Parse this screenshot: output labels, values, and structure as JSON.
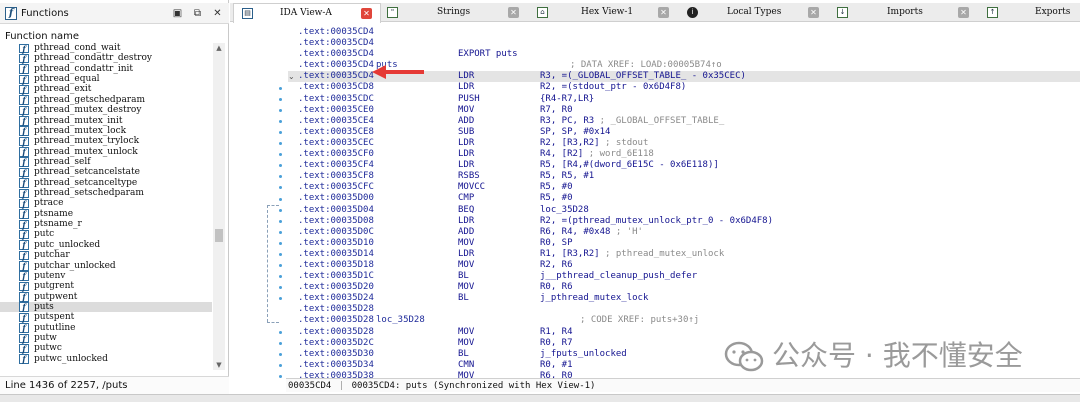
{
  "functions_panel": {
    "title": "Functions",
    "column_header": "Function name",
    "items": [
      "pthread_cond_wait",
      "pthread_condattr_destroy",
      "pthread_condattr_init",
      "pthread_equal",
      "pthread_exit",
      "pthread_getschedparam",
      "pthread_mutex_destroy",
      "pthread_mutex_init",
      "pthread_mutex_lock",
      "pthread_mutex_trylock",
      "pthread_mutex_unlock",
      "pthread_self",
      "pthread_setcancelstate",
      "pthread_setcanceltype",
      "pthread_setschedparam",
      "ptrace",
      "ptsname",
      "ptsname_r",
      "putc",
      "putc_unlocked",
      "putchar",
      "putchar_unlocked",
      "putenv",
      "putgrent",
      "putpwent",
      "puts",
      "putspent",
      "pututline",
      "putw",
      "putwc",
      "putwc_unlocked"
    ],
    "selected_item": "puts",
    "status": "Line 1436 of 2257, /puts"
  },
  "tabs": [
    {
      "label": "IDA View-A",
      "icon": "ida-view-icon",
      "active": true
    },
    {
      "label": "Strings",
      "icon": "strings-icon",
      "active": false
    },
    {
      "label": "Hex View-1",
      "icon": "hex-view-icon",
      "active": false
    },
    {
      "label": "Local Types",
      "icon": "local-types-icon",
      "active": false
    },
    {
      "label": "Imports",
      "icon": "imports-icon",
      "active": false
    },
    {
      "label": "Exports",
      "icon": "exports-icon",
      "active": false
    }
  ],
  "disasm_lines": [
    {
      "addr": ".text:00035CD4",
      "label": "",
      "mnem": "",
      "ops": "",
      "comment": ""
    },
    {
      "addr": ".text:00035CD4",
      "label": "",
      "mnem": "",
      "ops": "",
      "comment": ""
    },
    {
      "addr": ".text:00035CD4",
      "label": "",
      "mnem": "EXPORT puts",
      "ops": "",
      "comment": ""
    },
    {
      "addr": ".text:00035CD4",
      "label": "puts",
      "mnem": "",
      "ops": "",
      "comment": "; DATA XREF: LOAD:00005B74↑o"
    },
    {
      "addr": ".text:00035CD4",
      "label": "",
      "mnem": "LDR",
      "ops": "R3, =(_GLOBAL_OFFSET_TABLE_ - 0x35CEC)",
      "comment": "",
      "highlight": true
    },
    {
      "addr": ".text:00035CD8",
      "label": "",
      "mnem": "LDR",
      "ops": "R2, =(stdout_ptr - 0x6D4F8)",
      "comment": ""
    },
    {
      "addr": ".text:00035CDC",
      "label": "",
      "mnem": "PUSH",
      "ops": "{R4-R7,LR}",
      "comment": ""
    },
    {
      "addr": ".text:00035CE0",
      "label": "",
      "mnem": "MOV",
      "ops": "R7, R0",
      "comment": ""
    },
    {
      "addr": ".text:00035CE4",
      "label": "",
      "mnem": "ADD",
      "ops": "R3, PC, R3",
      "comment": "; _GLOBAL_OFFSET_TABLE_"
    },
    {
      "addr": ".text:00035CE8",
      "label": "",
      "mnem": "SUB",
      "ops": "SP, SP, #0x14",
      "comment": ""
    },
    {
      "addr": ".text:00035CEC",
      "label": "",
      "mnem": "LDR",
      "ops": "R2, [R3,R2]",
      "comment": "; stdout"
    },
    {
      "addr": ".text:00035CF0",
      "label": "",
      "mnem": "LDR",
      "ops": "R4, [R2]",
      "comment": "; word_6E118"
    },
    {
      "addr": ".text:00035CF4",
      "label": "",
      "mnem": "LDR",
      "ops": "R5, [R4,#(dword_6E15C - 0x6E118)]",
      "comment": ""
    },
    {
      "addr": ".text:00035CF8",
      "label": "",
      "mnem": "RSBS",
      "ops": "R5, R5, #1",
      "comment": ""
    },
    {
      "addr": ".text:00035CFC",
      "label": "",
      "mnem": "MOVCC",
      "ops": "R5, #0",
      "comment": ""
    },
    {
      "addr": ".text:00035D00",
      "label": "",
      "mnem": "CMP",
      "ops": "R5, #0",
      "comment": ""
    },
    {
      "addr": ".text:00035D04",
      "label": "",
      "mnem": "BEQ",
      "ops": "loc_35D28",
      "comment": ""
    },
    {
      "addr": ".text:00035D08",
      "label": "",
      "mnem": "LDR",
      "ops": "R2, =(pthread_mutex_unlock_ptr_0 - 0x6D4F8)",
      "comment": ""
    },
    {
      "addr": ".text:00035D0C",
      "label": "",
      "mnem": "ADD",
      "ops": "R6, R4, #0x48",
      "comment": "; 'H'"
    },
    {
      "addr": ".text:00035D10",
      "label": "",
      "mnem": "MOV",
      "ops": "R0, SP",
      "comment": ""
    },
    {
      "addr": ".text:00035D14",
      "label": "",
      "mnem": "LDR",
      "ops": "R1, [R3,R2]",
      "comment": "; pthread_mutex_unlock"
    },
    {
      "addr": ".text:00035D18",
      "label": "",
      "mnem": "MOV",
      "ops": "R2, R6",
      "comment": ""
    },
    {
      "addr": ".text:00035D1C",
      "label": "",
      "mnem": "BL",
      "ops": "j__pthread_cleanup_push_defer",
      "comment": ""
    },
    {
      "addr": ".text:00035D20",
      "label": "",
      "mnem": "MOV",
      "ops": "R0, R6",
      "comment": ""
    },
    {
      "addr": ".text:00035D24",
      "label": "",
      "mnem": "BL",
      "ops": "j_pthread_mutex_lock",
      "comment": ""
    },
    {
      "addr": ".text:00035D28",
      "label": "",
      "mnem": "",
      "ops": "",
      "comment": ""
    },
    {
      "addr": ".text:00035D28",
      "label": "loc_35D28",
      "mnem": "",
      "ops": "",
      "comment": "; CODE XREF: puts+30↑j"
    },
    {
      "addr": ".text:00035D28",
      "label": "",
      "mnem": "MOV",
      "ops": "R1, R4",
      "comment": ""
    },
    {
      "addr": ".text:00035D2C",
      "label": "",
      "mnem": "MOV",
      "ops": "R0, R7",
      "comment": ""
    },
    {
      "addr": ".text:00035D30",
      "label": "",
      "mnem": "BL",
      "ops": "j_fputs_unlocked",
      "comment": ""
    },
    {
      "addr": ".text:00035D34",
      "label": "",
      "mnem": "CMN",
      "ops": "R0, #1",
      "comment": ""
    },
    {
      "addr": ".text:00035D38",
      "label": "",
      "mnem": "MOV",
      "ops": "R6, R0",
      "comment": ""
    }
  ],
  "status_bar": {
    "address": "00035CD4",
    "message": "00035CD4: puts (Synchronized with Hex View-1)"
  },
  "watermark": {
    "text": "公众号 · 我不懂安全"
  },
  "colors": {
    "highlight_line": "#e4e4e4",
    "annotation_arrow": "#e53935",
    "active_tab_close": "#e0463b"
  }
}
